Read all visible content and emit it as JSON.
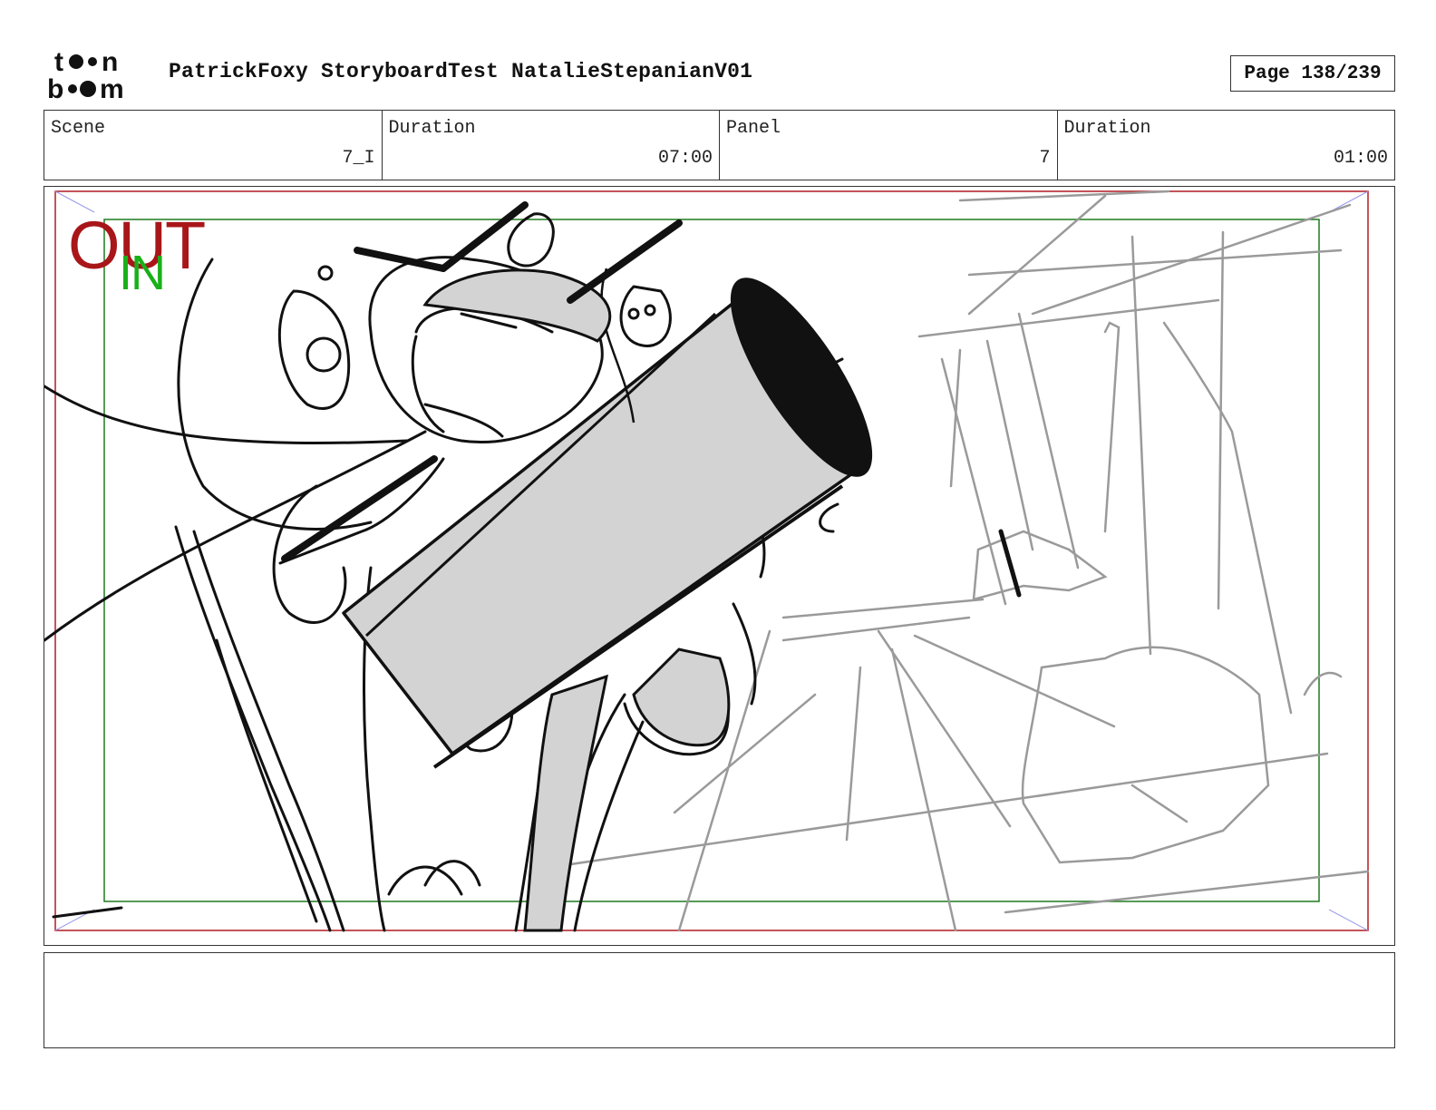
{
  "header": {
    "logo_text": "toon boom",
    "title": "PatrickFoxy StoryboardTest NatalieStepanianV01",
    "page_label": "Page 138/239"
  },
  "info": {
    "scene_label": "Scene",
    "scene_value": "7_I",
    "scene_duration_label": "Duration",
    "scene_duration_value": "07:00",
    "panel_label": "Panel",
    "panel_value": "7",
    "panel_duration_label": "Duration",
    "panel_duration_value": "01:00"
  },
  "frame_guides": {
    "out_label": "OUT",
    "in_label": "IN",
    "out_color": "#a8161a",
    "in_color": "#19b019"
  },
  "notes": {
    "text": ""
  }
}
